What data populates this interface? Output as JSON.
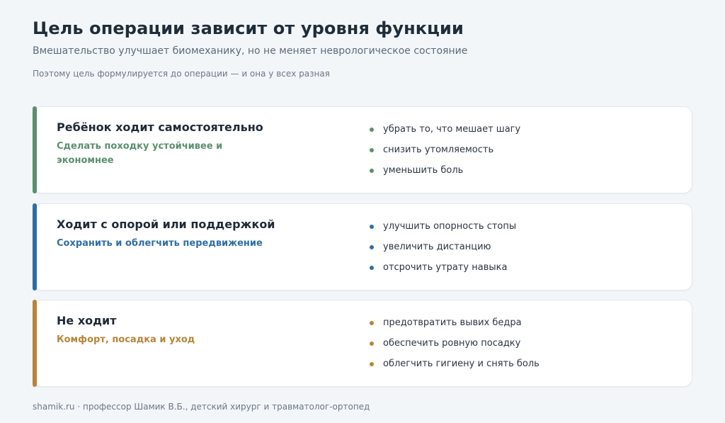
{
  "header": {
    "title": "Цель операции зависит от уровня функции",
    "subtitle": "Вмешательство улучшает биомеханику, но не меняет неврологическое состояние",
    "note": "Поэтому цель формулируется до операции — и она у всех разная"
  },
  "cards": [
    {
      "heading": "Ребёнок ходит самостоятельно",
      "goal": "Сделать походку устойчивее и экономнее",
      "accent": "#5a8f6e",
      "items": [
        "убрать то, что мешает шагу",
        "снизить утомляемость",
        "уменьшить боль"
      ]
    },
    {
      "heading": "Ходит с опорой или поддержкой",
      "goal": "Сохранить и облегчить передвижение",
      "accent": "#2f6ea5",
      "items": [
        "улучшить опорность стопы",
        "увеличить дистанцию",
        "отсрочить утрату навыка"
      ]
    },
    {
      "heading": "Не ходит",
      "goal": "Комфорт, посадка и уход",
      "accent": "#b7843a",
      "items": [
        "предотвратить вывих бедра",
        "обеспечить ровную посадку",
        "облегчить гигиену и снять боль"
      ]
    }
  ],
  "footer": {
    "text": "shamik.ru · профессор Шамик В.Б., детский хирург и травматолог-ортопед"
  }
}
